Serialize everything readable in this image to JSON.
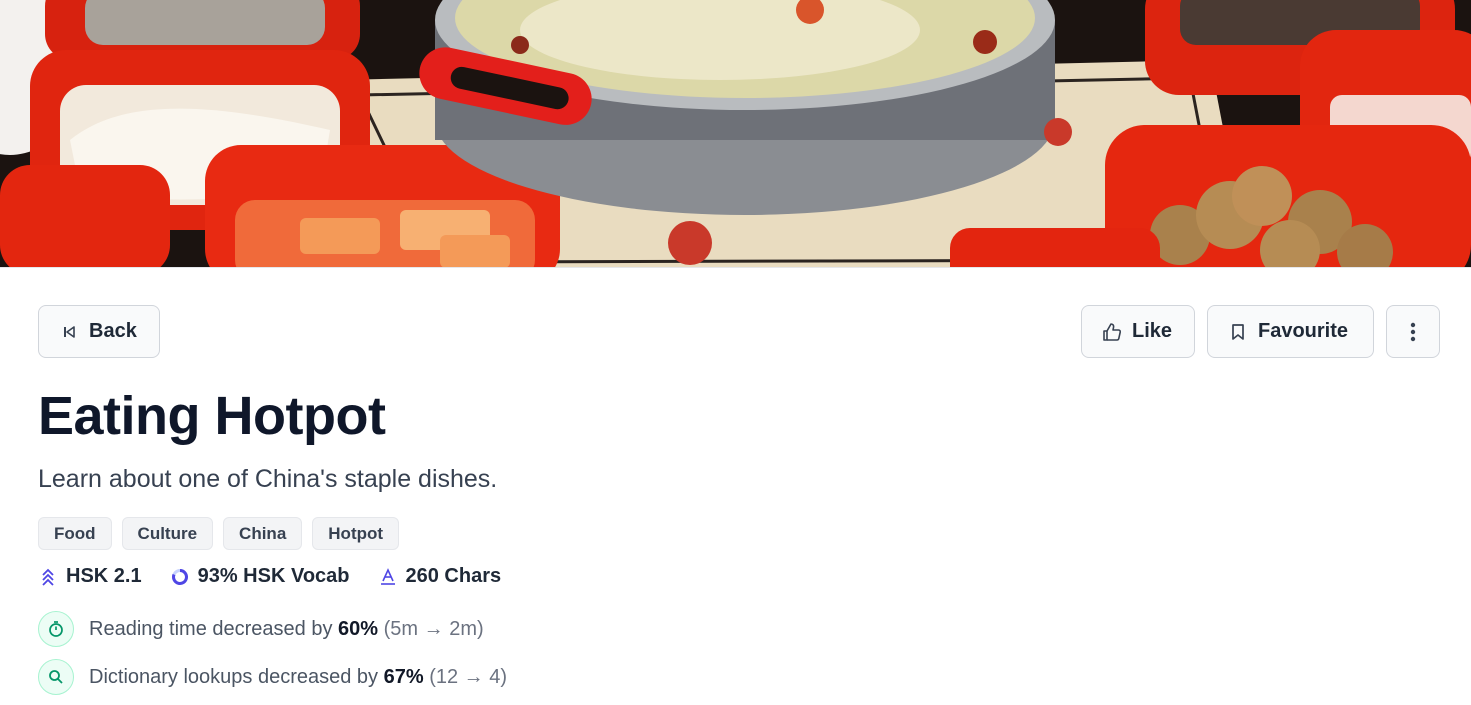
{
  "hero": {
    "icon": "hotpot-photo"
  },
  "toolbar": {
    "back_label": "Back",
    "like_label": "Like",
    "favourite_label": "Favourite"
  },
  "article": {
    "title": "Eating Hotpot",
    "subtitle": "Learn about one of China's staple dishes.",
    "tags": [
      "Food",
      "Culture",
      "China",
      "Hotpot"
    ],
    "stats": {
      "hsk_level": "HSK 2.1",
      "hsk_vocab": "93% HSK Vocab",
      "chars": "260 Chars"
    },
    "metrics": [
      {
        "prefix": "Reading time decreased by",
        "percent": "60%",
        "detail": "(5m → 2m)"
      },
      {
        "prefix": "Dictionary lookups decreased by",
        "percent": "67%",
        "detail": "(12 → 4)"
      }
    ]
  },
  "colors": {
    "accent": "#4f46e5",
    "success": "#059669",
    "tag_bg": "#f3f4f6"
  }
}
